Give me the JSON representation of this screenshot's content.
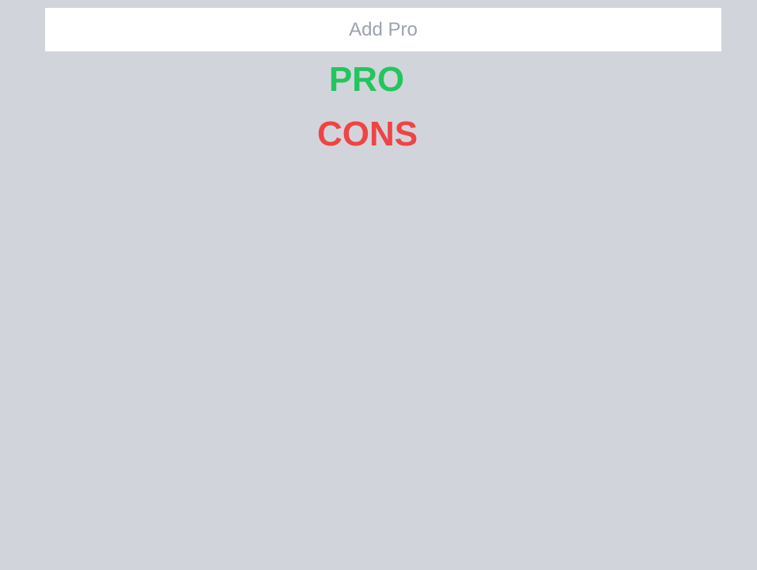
{
  "input": {
    "placeholder": "Add Pro",
    "value": ""
  },
  "sections": {
    "pro": {
      "label": "PRO",
      "color": "#22c55e"
    },
    "cons": {
      "label": "CONS",
      "color": "#ef4444"
    }
  },
  "colors": {
    "background": "#d1d5db",
    "input_background": "#ffffff",
    "placeholder": "#9ca3af"
  }
}
